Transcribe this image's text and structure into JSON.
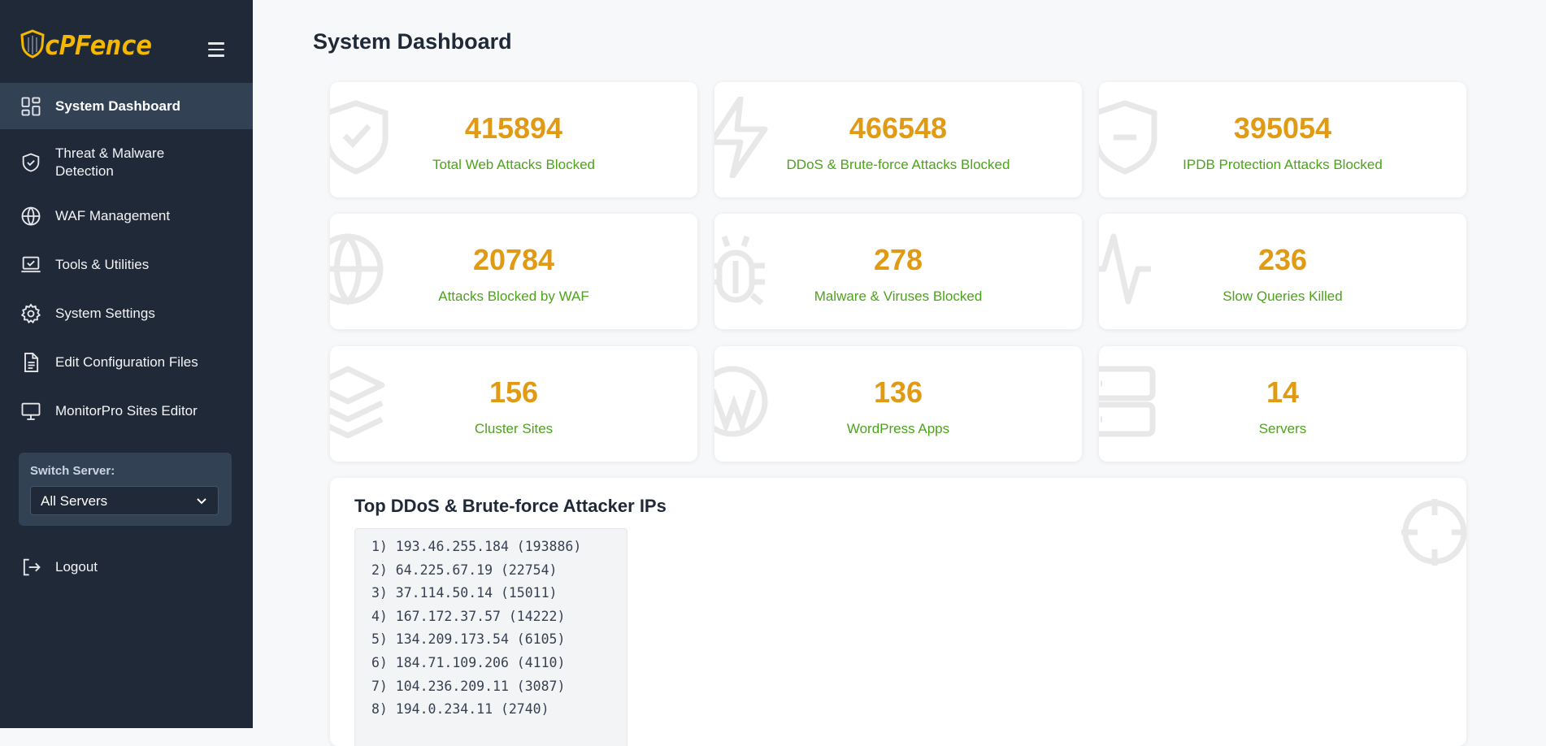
{
  "app": {
    "logo_text": "cPFence"
  },
  "sidebar": {
    "items": [
      {
        "label": "System Dashboard",
        "icon": "dashboard-icon",
        "active": true
      },
      {
        "label": "Threat & Malware Detection",
        "label_line1": "Threat & Malware",
        "label_line2": "Detection",
        "icon": "shield-check-icon"
      },
      {
        "label": "WAF Management",
        "icon": "globe-icon"
      },
      {
        "label": "Tools & Utilities",
        "icon": "laptop-check-icon"
      },
      {
        "label": "System Settings",
        "icon": "gear-icon"
      },
      {
        "label": "Edit Configuration Files",
        "icon": "file-text-icon"
      },
      {
        "label": "MonitorPro Sites Editor",
        "icon": "monitor-icon"
      }
    ],
    "switch_server": {
      "label": "Switch Server:",
      "selected": "All Servers"
    },
    "logout": {
      "label": "Logout",
      "icon": "logout-icon"
    }
  },
  "main": {
    "title": "System Dashboard",
    "cards": [
      {
        "value": "415894",
        "label": "Total Web Attacks Blocked",
        "icon": "shield-check-icon"
      },
      {
        "value": "466548",
        "label": "DDoS & Brute-force Attacks Blocked",
        "icon": "lightning-icon"
      },
      {
        "value": "395054",
        "label": "IPDB Protection Attacks Blocked",
        "icon": "shield-minus-icon"
      },
      {
        "value": "20784",
        "label": "Attacks Blocked by WAF",
        "icon": "globe-icon"
      },
      {
        "value": "278",
        "label": "Malware & Viruses Blocked",
        "icon": "bug-icon"
      },
      {
        "value": "236",
        "label": "Slow Queries Killed",
        "icon": "activity-icon"
      },
      {
        "value": "156",
        "label": "Cluster Sites",
        "icon": "layers-icon"
      },
      {
        "value": "136",
        "label": "WordPress Apps",
        "icon": "wordpress-icon"
      },
      {
        "value": "14",
        "label": "Servers",
        "icon": "server-icon"
      }
    ],
    "top_ips": {
      "title": "Top DDoS & Brute-force Attacker IPs",
      "icon": "crosshair-icon",
      "lines": [
        "1) 193.46.255.184 (193886)",
        "2) 64.225.67.19 (22754)",
        "3) 37.114.50.14 (15011)",
        "4) 167.172.37.57 (14222)",
        "5) 134.209.173.54 (6105)",
        "6) 184.71.109.206 (4110)",
        "7) 104.236.209.11 (3087)",
        "8) 194.0.234.11 (2740)"
      ]
    }
  },
  "colors": {
    "sidebar_bg": "#1f2937",
    "sidebar_active": "#334155",
    "value_orange": "#e09a13",
    "label_green": "#4da31a",
    "logo_yellow": "#f5b800"
  }
}
